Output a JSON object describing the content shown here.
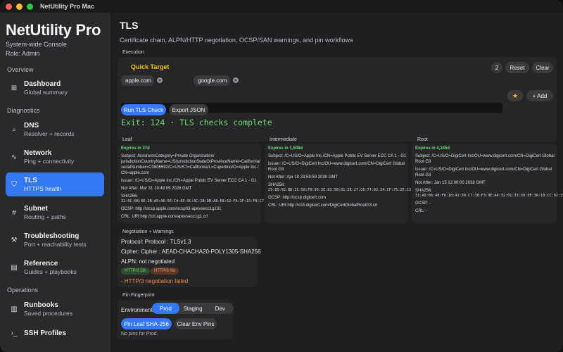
{
  "window": {
    "title": "NetUtility Pro Mac"
  },
  "sidebar": {
    "app_name": "NetUtility Pro",
    "subtitle": "System-wide Console",
    "role": "Role: Admin",
    "sections": [
      {
        "label": "Overview"
      },
      {
        "label": "Diagnostics"
      },
      {
        "label": "Operations"
      }
    ],
    "items": [
      {
        "title": "Dashboard",
        "subtitle": "Global summary",
        "icon": "grid-icon",
        "glyph": "⊞"
      },
      {
        "title": "DNS",
        "subtitle": "Resolver + records",
        "icon": "search-icon",
        "glyph": "⌕"
      },
      {
        "title": "Network",
        "subtitle": "Ping + connectivity",
        "icon": "pulse-icon",
        "glyph": "∿"
      },
      {
        "title": "TLS",
        "subtitle": "HTTPS health",
        "icon": "shield-icon",
        "glyph": "⛉"
      },
      {
        "title": "Subnet",
        "subtitle": "Routing + paths",
        "icon": "hash-icon",
        "glyph": "#"
      },
      {
        "title": "Troubleshooting",
        "subtitle": "Port + reachability tests",
        "icon": "wrench-icon",
        "glyph": "⚒"
      },
      {
        "title": "Reference",
        "subtitle": "Guides + playbooks",
        "icon": "book-icon",
        "glyph": "▤"
      },
      {
        "title": "Runbooks",
        "subtitle": "Saved procedures",
        "icon": "chart-icon",
        "glyph": "▥"
      },
      {
        "title": "SSH Profiles",
        "subtitle": "",
        "icon": "terminal-icon",
        "glyph": "›_"
      }
    ]
  },
  "main": {
    "title": "TLS",
    "subtitle": "Certificate chain, ALPN/HTTP negotiation, OCSP/SAN warnings, and pin workflows",
    "execution": {
      "label": "Execution",
      "quick_target": "Quick Target",
      "count": "2",
      "reset_label": "Reset",
      "clear_label": "Clear",
      "chips": [
        "apple.com",
        "google.com"
      ],
      "input_value": "apple.com",
      "star_glyph": "★",
      "add_label": "+ Add",
      "run_label": "Run TLS Check",
      "export_label": "Export JSON",
      "exit_text": "Exit: 124 · TLS checks complete"
    },
    "certs": [
      {
        "heading": "Leaf",
        "expires": "Expires in 37d",
        "subject": "Subject: /businessCategory=Private Organization/ jurisdictionCountryName=US/jurisdictionStateOrProvinceName=California/ serialNumber=C0806592/C=US/ST=California/L=Cupertino/O=Apple Inc./ CN=apple.com",
        "issuer": "Issuer: /C=US/O=Apple Inc./CN=Apple Public EV Server ECC CA 1 - G1",
        "not_after": "Not After: Mar 31 19:48:09 2026 GMT",
        "sha_label": "SHA256:",
        "sha": "32:0C:08:0E:2B:A0:A6:5E:C4:05:9C:6C:2B:DB:A8:E8:62:FA:2F:15:F8:C7:E1:DC:BB:F9:00:6D:C7:D7:12:FA:66",
        "ocsp": "OCSP: http://ocsp.apple.com/ocsp03-apevsecc1g101",
        "crl": "CRL: URI:http://crl.apple.com/apevsecc1g1.crl"
      },
      {
        "heading": "Intermediate",
        "expires": "Expires in 1,508d",
        "subject": "Subject: /C=US/O=Apple Inc./CN=Apple Public EV Server ECC CA 1 - G1",
        "issuer": "Issuer: /C=US/O=DigiCert Inc/OU=www.digicert.com/CN=DigiCert Global Root G3",
        "not_after": "Not After: Apr 10 23:59:59 2030 GMT",
        "sha_label": "SHA256:",
        "sha": "25:85:92:BD:2C:58:F0:95:2E:02:58:D1:2E:27:C6:77:62:24:CF:75:2E:C3:62:03:03:1C:DD:49:35:18:44:D4",
        "ocsp": "OCSP: http://ocsp.digicert.com",
        "crl": "CRL: URI:http://crl3.digicert.com/DigiCertGlobalRootG3.crl"
      },
      {
        "heading": "Root",
        "expires": "Expires in 4,345d",
        "subject": "Subject: /C=US/O=DigiCert Inc/OU=www.digicert.com/CN=DigiCert Global Root G3",
        "issuer": "Issuer: /C=US/O=DigiCert Inc/OU=www.digicert.com/CN=DigiCert Global Root G3",
        "not_after": "Not After: Jan 15 12:00:00 2038 GMT",
        "sha_label": "SHA256:",
        "sha": "31:AD:66:48:F8:10:41:38:C7:38:F3:9E:A4:32:01:33:39:3E:3A:18:CC:02:29:6E:F9:7C:2A:C9:EF:67:31:D0",
        "ocsp": "OCSP: -",
        "crl": "CRL: -"
      }
    ],
    "negotiation": {
      "label": "Negotiation + Warnings",
      "protocol": "Protocol: Protocol  : TLSv1.3",
      "cipher": "Cipher: Cipher    : AEAD-CHACHA20-POLY1305-SHA256",
      "alpn": "ALPN: not negotiated",
      "tag_ok": "HTTP/2 OK",
      "tag_no": "HTTP/3 No",
      "warning": "- HTTP/3 negotiation failed"
    },
    "pin": {
      "label": "Pin Fingerprint",
      "env_label": "Environment",
      "envs": [
        "Prod",
        "Staging",
        "Dev"
      ],
      "pin_label": "Pin Leaf SHA-256",
      "clear_label": "Clear Env Pins",
      "status": "No pins for Prod."
    }
  }
}
